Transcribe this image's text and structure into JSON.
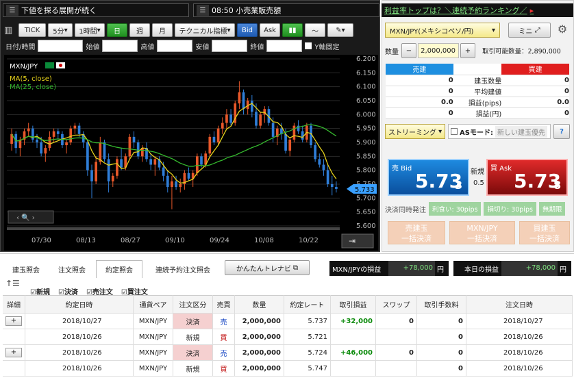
{
  "news": {
    "left": "下値を探る展開が続く",
    "middle": "08:50 小売業販売額",
    "right": "利益率トップは？＼連続予約ランキング／"
  },
  "toolbar": {
    "tick": "TICK",
    "period": "5分",
    "range": "1時間",
    "day": "日",
    "week": "週",
    "month": "月",
    "indicator": "テクニカル指標",
    "bid": "Bid",
    "ask": "Ask"
  },
  "ohlc": {
    "datetime": "日付/時間",
    "open": "始値",
    "high": "高値",
    "low": "安値",
    "close": "終値",
    "yfix": "Y軸固定"
  },
  "chart_data": {
    "type": "candlestick",
    "symbol": "MXN/JPY",
    "legend": [
      "MA(5, close)",
      "MA(25, close)"
    ],
    "colors": {
      "up": "#e8582a",
      "down": "#2f7ed8",
      "ma5": "#e6d21c",
      "ma25": "#35b82e"
    },
    "ylim": [
      5.6,
      6.2
    ],
    "yticks": [
      6.2,
      6.15,
      6.1,
      6.05,
      6.0,
      5.95,
      5.9,
      5.85,
      5.8,
      5.75,
      5.7,
      5.65,
      5.6
    ],
    "ytick_labels": [
      "6.200",
      "6.150",
      "6.100",
      "6.050",
      "6.000",
      "5.950",
      "5.900",
      "5.850",
      "5.800",
      "5.750",
      "5.700",
      "5.650",
      "5.600"
    ],
    "xtick_labels": [
      "07/30",
      "08/13",
      "08/27",
      "09/10",
      "09/24",
      "10/08",
      "10/22"
    ],
    "last_price": "5.733",
    "candles": [
      [
        5.895,
        5.95,
        5.87,
        5.93
      ],
      [
        5.93,
        5.94,
        5.86,
        5.88
      ],
      [
        5.88,
        5.92,
        5.85,
        5.91
      ],
      [
        5.91,
        5.95,
        5.89,
        5.94
      ],
      [
        5.94,
        5.97,
        5.92,
        5.95
      ],
      [
        5.95,
        5.96,
        5.9,
        5.91
      ],
      [
        5.91,
        5.93,
        5.88,
        5.9
      ],
      [
        5.9,
        5.92,
        5.85,
        5.86
      ],
      [
        5.86,
        5.89,
        5.83,
        5.88
      ],
      [
        5.88,
        5.94,
        5.87,
        5.92
      ],
      [
        5.92,
        5.95,
        5.9,
        5.94
      ],
      [
        5.94,
        5.95,
        5.91,
        5.93
      ],
      [
        5.93,
        5.94,
        5.88,
        5.89
      ],
      [
        5.89,
        5.91,
        5.86,
        5.9
      ],
      [
        5.9,
        5.96,
        5.89,
        5.95
      ],
      [
        5.95,
        5.97,
        5.93,
        5.96
      ],
      [
        5.96,
        5.97,
        5.92,
        5.93
      ],
      [
        5.93,
        5.94,
        5.88,
        5.9
      ],
      [
        5.9,
        5.91,
        5.78,
        5.8
      ],
      [
        5.8,
        5.82,
        5.7,
        5.76
      ],
      [
        5.76,
        5.85,
        5.75,
        5.83
      ],
      [
        5.83,
        5.92,
        5.82,
        5.9
      ],
      [
        5.9,
        5.91,
        5.83,
        5.84
      ],
      [
        5.84,
        5.86,
        5.72,
        5.76
      ],
      [
        5.76,
        5.79,
        5.74,
        5.78
      ],
      [
        5.78,
        5.85,
        5.77,
        5.84
      ],
      [
        5.84,
        5.88,
        5.8,
        5.81
      ],
      [
        5.81,
        5.86,
        5.8,
        5.85
      ],
      [
        5.85,
        5.93,
        5.84,
        5.92
      ],
      [
        5.92,
        5.94,
        5.88,
        5.9
      ],
      [
        5.9,
        5.91,
        5.84,
        5.85
      ],
      [
        5.85,
        5.89,
        5.83,
        5.88
      ],
      [
        5.88,
        5.9,
        5.83,
        5.84
      ],
      [
        5.84,
        5.86,
        5.8,
        5.82
      ],
      [
        5.82,
        5.85,
        5.78,
        5.84
      ],
      [
        5.84,
        5.85,
        5.8,
        5.81
      ],
      [
        5.81,
        5.83,
        5.76,
        5.78
      ],
      [
        5.78,
        5.8,
        5.72,
        5.74
      ],
      [
        5.74,
        5.78,
        5.66,
        5.76
      ],
      [
        5.76,
        5.78,
        5.73,
        5.74
      ],
      [
        5.74,
        5.77,
        5.72,
        5.75
      ],
      [
        5.75,
        5.8,
        5.73,
        5.79
      ],
      [
        5.79,
        5.81,
        5.76,
        5.77
      ],
      [
        5.77,
        5.8,
        5.74,
        5.79
      ],
      [
        5.79,
        5.86,
        5.78,
        5.85
      ],
      [
        5.85,
        5.86,
        5.81,
        5.82
      ],
      [
        5.82,
        5.87,
        5.81,
        5.86
      ],
      [
        5.86,
        5.93,
        5.85,
        5.92
      ],
      [
        5.92,
        5.94,
        5.89,
        5.9
      ],
      [
        5.9,
        5.96,
        5.89,
        5.95
      ],
      [
        5.95,
        5.99,
        5.93,
        5.97
      ],
      [
        5.97,
        6.02,
        5.95,
        6.0
      ],
      [
        6.0,
        6.02,
        5.96,
        5.97
      ],
      [
        5.97,
        6.05,
        5.96,
        6.04
      ],
      [
        6.04,
        6.12,
        6.02,
        6.08
      ],
      [
        6.08,
        6.09,
        6.0,
        6.02
      ],
      [
        6.02,
        6.06,
        6.0,
        6.05
      ],
      [
        6.05,
        6.07,
        5.99,
        6.01
      ],
      [
        6.01,
        6.04,
        5.95,
        5.96
      ],
      [
        5.96,
        6.01,
        5.95,
        6.0
      ],
      [
        6.0,
        6.03,
        5.97,
        6.02
      ],
      [
        6.02,
        6.03,
        5.96,
        5.97
      ],
      [
        5.97,
        5.99,
        5.9,
        5.92
      ],
      [
        5.92,
        5.96,
        5.89,
        5.95
      ],
      [
        5.95,
        5.97,
        5.91,
        5.93
      ],
      [
        5.93,
        5.95,
        5.86,
        5.87
      ],
      [
        5.87,
        5.92,
        5.85,
        5.91
      ],
      [
        5.91,
        5.97,
        5.9,
        5.96
      ],
      [
        5.96,
        5.98,
        5.93,
        5.94
      ],
      [
        5.94,
        5.96,
        5.9,
        5.91
      ],
      [
        5.91,
        5.97,
        5.9,
        5.96
      ],
      [
        5.96,
        5.97,
        5.88,
        5.89
      ],
      [
        5.89,
        5.9,
        5.83,
        5.84
      ],
      [
        5.84,
        5.86,
        5.81,
        5.82
      ],
      [
        5.82,
        5.84,
        5.78,
        5.8
      ],
      [
        5.8,
        5.82,
        5.74,
        5.75
      ],
      [
        5.75,
        5.78,
        5.71,
        5.74
      ],
      [
        5.74,
        5.76,
        5.72,
        5.733
      ]
    ]
  },
  "order": {
    "pair": "MXN/JPY(メキシコペソ/円)",
    "mini": "ミニ",
    "qty_label": "数量",
    "minus": "−",
    "qty": "2,000,000",
    "plus": "+",
    "available": "取引可能数量：2,890,000"
  },
  "position": {
    "sell": "売建",
    "buy": "買建",
    "rows": [
      {
        "l": "0",
        "label": "建玉数量",
        "r": "0"
      },
      {
        "l": "0",
        "label": "平均建値",
        "r": "0"
      },
      {
        "l": "0.0",
        "label": "損益(pips)",
        "r": "0.0"
      },
      {
        "l": "0",
        "label": "損益(円)",
        "r": "0"
      }
    ]
  },
  "streaming": {
    "label": "ストリーミング",
    "as": "ASモード:",
    "as_hint": "新しい建玉優先",
    "help": "?"
  },
  "quote": {
    "bid_label": "売 Bid",
    "bid_main": "5.73",
    "bid_small": "3",
    "spread_label": "新規",
    "spread": "0.5",
    "ask_label": "買 Ask",
    "ask_main": "5.73",
    "ask_small": "8"
  },
  "settle": {
    "label": "決済同時発注",
    "profit": "利食い: 30pips",
    "loss": "損切り: 30pips",
    "none": "無期限"
  },
  "bulk": {
    "sell1": "売建玉",
    "sell2": "一括決済",
    "pair1": "MXN/JPY",
    "pair2": "一括決済",
    "buy1": "買建玉",
    "buy2": "一括決済"
  },
  "tabs": [
    "建玉照会",
    "注文照会",
    "約定照会",
    "連続予約注文照会"
  ],
  "navi": "かんたんトレナビ",
  "pnl": {
    "pair_label": "MXN/JPYの損益",
    "pair_value": "+78,000",
    "unit": "円",
    "today_label": "本日の損益",
    "today_value": "+78,000"
  },
  "filters": [
    "新規",
    "決済",
    "売注文",
    "買注文"
  ],
  "grid": {
    "headers": [
      "詳細",
      "約定日時",
      "通貨ペア",
      "注文区分",
      "売買",
      "数量",
      "約定レート",
      "取引損益",
      "スワップ",
      "取引手数料",
      "注文日時"
    ],
    "rows": [
      {
        "detail": "+",
        "date": "2018/10/27",
        "pair": "MXN/JPY",
        "kind": "決済",
        "side": "売",
        "qty": "2,000,000",
        "rate": "5.737",
        "pl": "+32,000",
        "swap": "0",
        "fee": "0",
        "odate": "2018/10/27"
      },
      {
        "detail": "",
        "date": "2018/10/26",
        "pair": "MXN/JPY",
        "kind": "新規",
        "side": "買",
        "qty": "2,000,000",
        "rate": "5.721",
        "pl": "",
        "swap": "",
        "fee": "0",
        "odate": "2018/10/26"
      },
      {
        "detail": "+",
        "date": "2018/10/26",
        "pair": "MXN/JPY",
        "kind": "決済",
        "side": "売",
        "qty": "2,000,000",
        "rate": "5.724",
        "pl": "+46,000",
        "swap": "0",
        "fee": "0",
        "odate": "2018/10/26"
      },
      {
        "detail": "",
        "date": "2018/10/26",
        "pair": "MXN/JPY",
        "kind": "新規",
        "side": "買",
        "qty": "2,000,000",
        "rate": "5.747",
        "pl": "",
        "swap": "",
        "fee": "0",
        "odate": "2018/10/26"
      }
    ]
  }
}
